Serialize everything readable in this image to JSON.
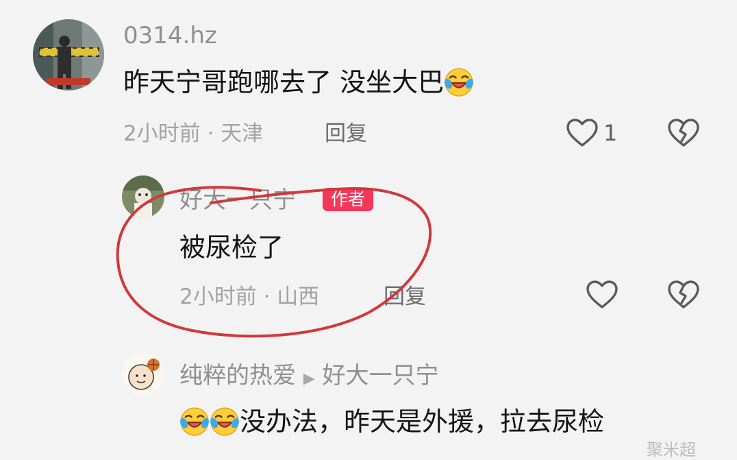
{
  "comments": [
    {
      "username": "0314.hz",
      "text": "昨天宁哥跑哪去了 没坐大巴",
      "emoji": "laugh-cry-emoji",
      "time_location": "2小时前 · 天津",
      "reply_label": "回复",
      "like_count": "1"
    },
    {
      "username": "好大一只宁",
      "author_badge": "作者",
      "text": "被尿检了",
      "time_location": "2小时前 · 山西",
      "reply_label": "回复",
      "circled": true
    },
    {
      "username": "纯粹的热爱",
      "reply_to": "好大一只宁",
      "emoji": "laugh-cry-emoji",
      "text": "没办法，昨天是外援，拉去尿检"
    }
  ],
  "annotation_color": "#d2373a",
  "accent_color": "#f4375b",
  "watermark": "聚米超"
}
